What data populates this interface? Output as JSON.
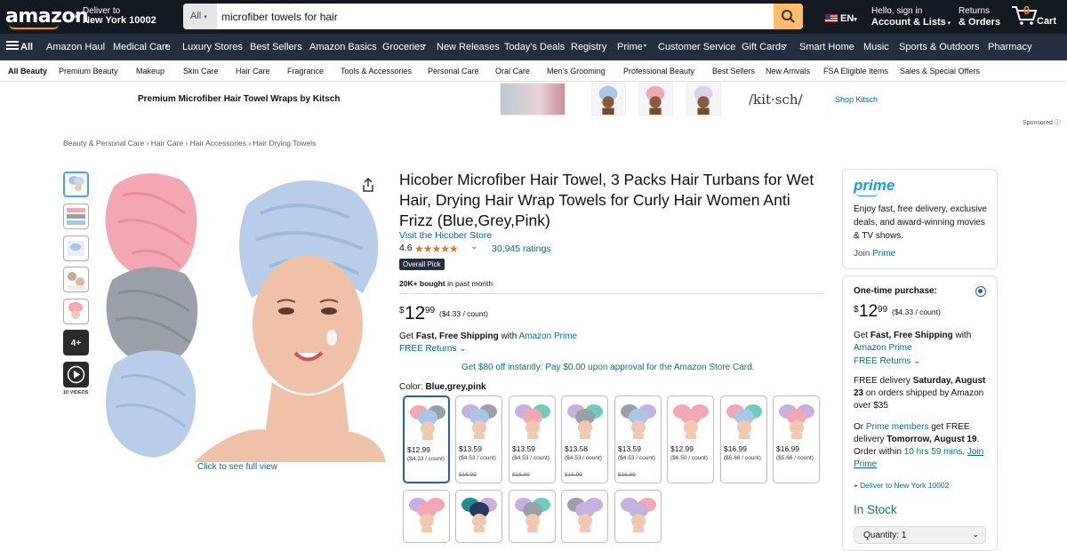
{
  "header": {
    "logo": "amazon",
    "deliver_line1": "Deliver to",
    "deliver_line2": "New York 10002",
    "search_category": "All",
    "search_value": "microfiber towels for hair",
    "lang": "EN",
    "account_line1": "Hello, sign in",
    "account_line2": "Account & Lists",
    "orders_line1": "Returns",
    "orders_line2": "& Orders",
    "cart_count": "0",
    "cart_label": "Cart"
  },
  "nav_main": [
    "All",
    "Amazon Haul",
    "Medical Care",
    "Luxury Stores",
    "Best Sellers",
    "Amazon Basics",
    "Groceries",
    "New Releases",
    "Today's Deals",
    "Registry",
    "Prime",
    "Customer Service",
    "Gift Cards",
    "Smart Home",
    "Music",
    "Sports & Outdoors",
    "Pharmacy"
  ],
  "nav_sub": [
    "All Beauty",
    "Premium Beauty",
    "Makeup",
    "Skin Care",
    "Hair Care",
    "Fragrance",
    "Tools & Accessories",
    "Personal Care",
    "Oral Care",
    "Men's Grooming",
    "Professional Beauty",
    "Best Sellers",
    "New Arrivals",
    "FSA Eligible Items",
    "Sales & Special Offers"
  ],
  "banner": {
    "text": "Premium Microfiber Hair Towel Wraps by Kitsch",
    "brand_logo": "/kit·sch/",
    "shop_link": "Shop Kitsch",
    "sponsored": "Sponsored"
  },
  "breadcrumb": "Beauty & Personal Care › Hair Care › Hair Accessories › Hair Drying Towels",
  "gallery": {
    "more_thumbs": "4+",
    "videos_label": "10 VIDEOS",
    "full_view": "Click to see full view"
  },
  "product": {
    "title": "Hicober Microfiber Hair Towel, 3 Packs Hair Turbans for Wet Hair, Drying Hair Wrap Towels for Curly Hair Women Anti Frizz (Blue,Grey,Pink)",
    "store_link": "Visit the Hicober Store",
    "rating": "4.6",
    "stars": "★★★★★",
    "ratings_count": "30,945 ratings",
    "badge": "Overall Pick",
    "bought_bold": "20K+ bought",
    "bought_rest": " in past month",
    "price_symbol": "$",
    "price_whole": "12",
    "price_fraction": "99",
    "price_unit": "($4.33 / count)",
    "ship_pre": "Get ",
    "ship_bold": "Fast, Free Shipping",
    "ship_mid": " with ",
    "ship_link": "Amazon Prime",
    "free_returns": "FREE Returns",
    "promo": "Get $80 off instantly: Pay $0.00 upon approval for the Amazon Store Card.",
    "color_label": "Color: ",
    "color_value": "Blue,grey,pink"
  },
  "swatches": [
    {
      "price": "$12.99",
      "unit": "($4.33 / count)",
      "strike": "",
      "colors": [
        "#f2a7b3",
        "#a9c6e8",
        "#9aa0a8"
      ]
    },
    {
      "price": "$13.59",
      "unit": "($4.53 / count)",
      "strike": "$16.99",
      "colors": [
        "#c4b1e2",
        "#a9c6e8",
        "#9aa0a8"
      ]
    },
    {
      "price": "$13.59",
      "unit": "($4.53 / count)",
      "strike": "$16.99",
      "colors": [
        "#c4b1e2",
        "#f2a7b3",
        "#6ad0bb"
      ]
    },
    {
      "price": "$13.58",
      "unit": "($4.53 / count)",
      "strike": "$16.99",
      "colors": [
        "#c4b1e2",
        "#9aa0a8",
        "#6ad0bb"
      ]
    },
    {
      "price": "$13.59",
      "unit": "($4.53 / count)",
      "strike": "$16.99",
      "colors": [
        "#9aa0a8",
        "#a9c6e8",
        "#c4b1e2"
      ]
    },
    {
      "price": "$12.99",
      "unit": "($6.50 / count)",
      "strike": "",
      "colors": [
        "#f2a7b3",
        "#f2a7b3",
        "#f2a7b3"
      ]
    },
    {
      "price": "$16.99",
      "unit": "($5.66 / count)",
      "strike": "",
      "colors": [
        "#f2a7b3",
        "#a9c6e8",
        "#6ad0bb"
      ]
    },
    {
      "price": "$16.99",
      "unit": "($5.66 / count)",
      "strike": "",
      "colors": [
        "#c4b1e2",
        "#f2a7b3",
        "#c4b1e2"
      ]
    }
  ],
  "swatches_row2": [
    {
      "colors": [
        "#c4b1e2",
        "#f2a7b3",
        "#f2a7b3"
      ]
    },
    {
      "colors": [
        "#1f8f94",
        "#2b3a5c",
        "#c4b1e2"
      ]
    },
    {
      "colors": [
        "#c4b1e2",
        "#9aa0a8",
        "#6ad0bb"
      ]
    },
    {
      "colors": [
        "#9aa0a8",
        "#c4b1e2",
        "#c4b1e2"
      ]
    },
    {
      "colors": [
        "#c4b1e2",
        "#c4b1e2",
        "#f2a7b3"
      ]
    }
  ],
  "prime_box": {
    "logo": "prime",
    "desc": "Enjoy fast, free delivery, exclusive deals, and award-winning movies & TV shows.",
    "join": "Join Prime"
  },
  "buy_box": {
    "onetime": "One-time purchase:",
    "price_symbol": "$",
    "price_whole": "12",
    "price_fraction": "99",
    "price_unit": "($4.33 / count)",
    "ship_pre": "Get ",
    "ship_bold": "Fast, Free Shipping",
    "ship_mid": " with ",
    "ship_link": "Amazon Prime",
    "free_returns": "FREE Returns",
    "delivery_pre": "FREE delivery ",
    "delivery_bold": "Saturday, August 23",
    "delivery_post": " on orders shipped by Amazon over $35",
    "or_text": "Or ",
    "prime_members": "Prime members",
    "fastest_mid": " get FREE delivery ",
    "fastest_bold": "Tomorrow, August 19",
    "order_within_pre": ". Order within ",
    "order_within": "10 hrs 59 mins",
    "order_within_post": ". ",
    "join_prime": "Join Prime",
    "deliver_to": "Deliver to New York 10002",
    "in_stock": "In Stock",
    "qty_label": "Quantity:",
    "qty_value": "1"
  },
  "colors": {
    "nav_dark": "#131921",
    "nav_secondary": "#232f3e",
    "search_button": "#febd69",
    "link": "#007185",
    "star": "#de7921",
    "in_stock": "#067d62"
  }
}
